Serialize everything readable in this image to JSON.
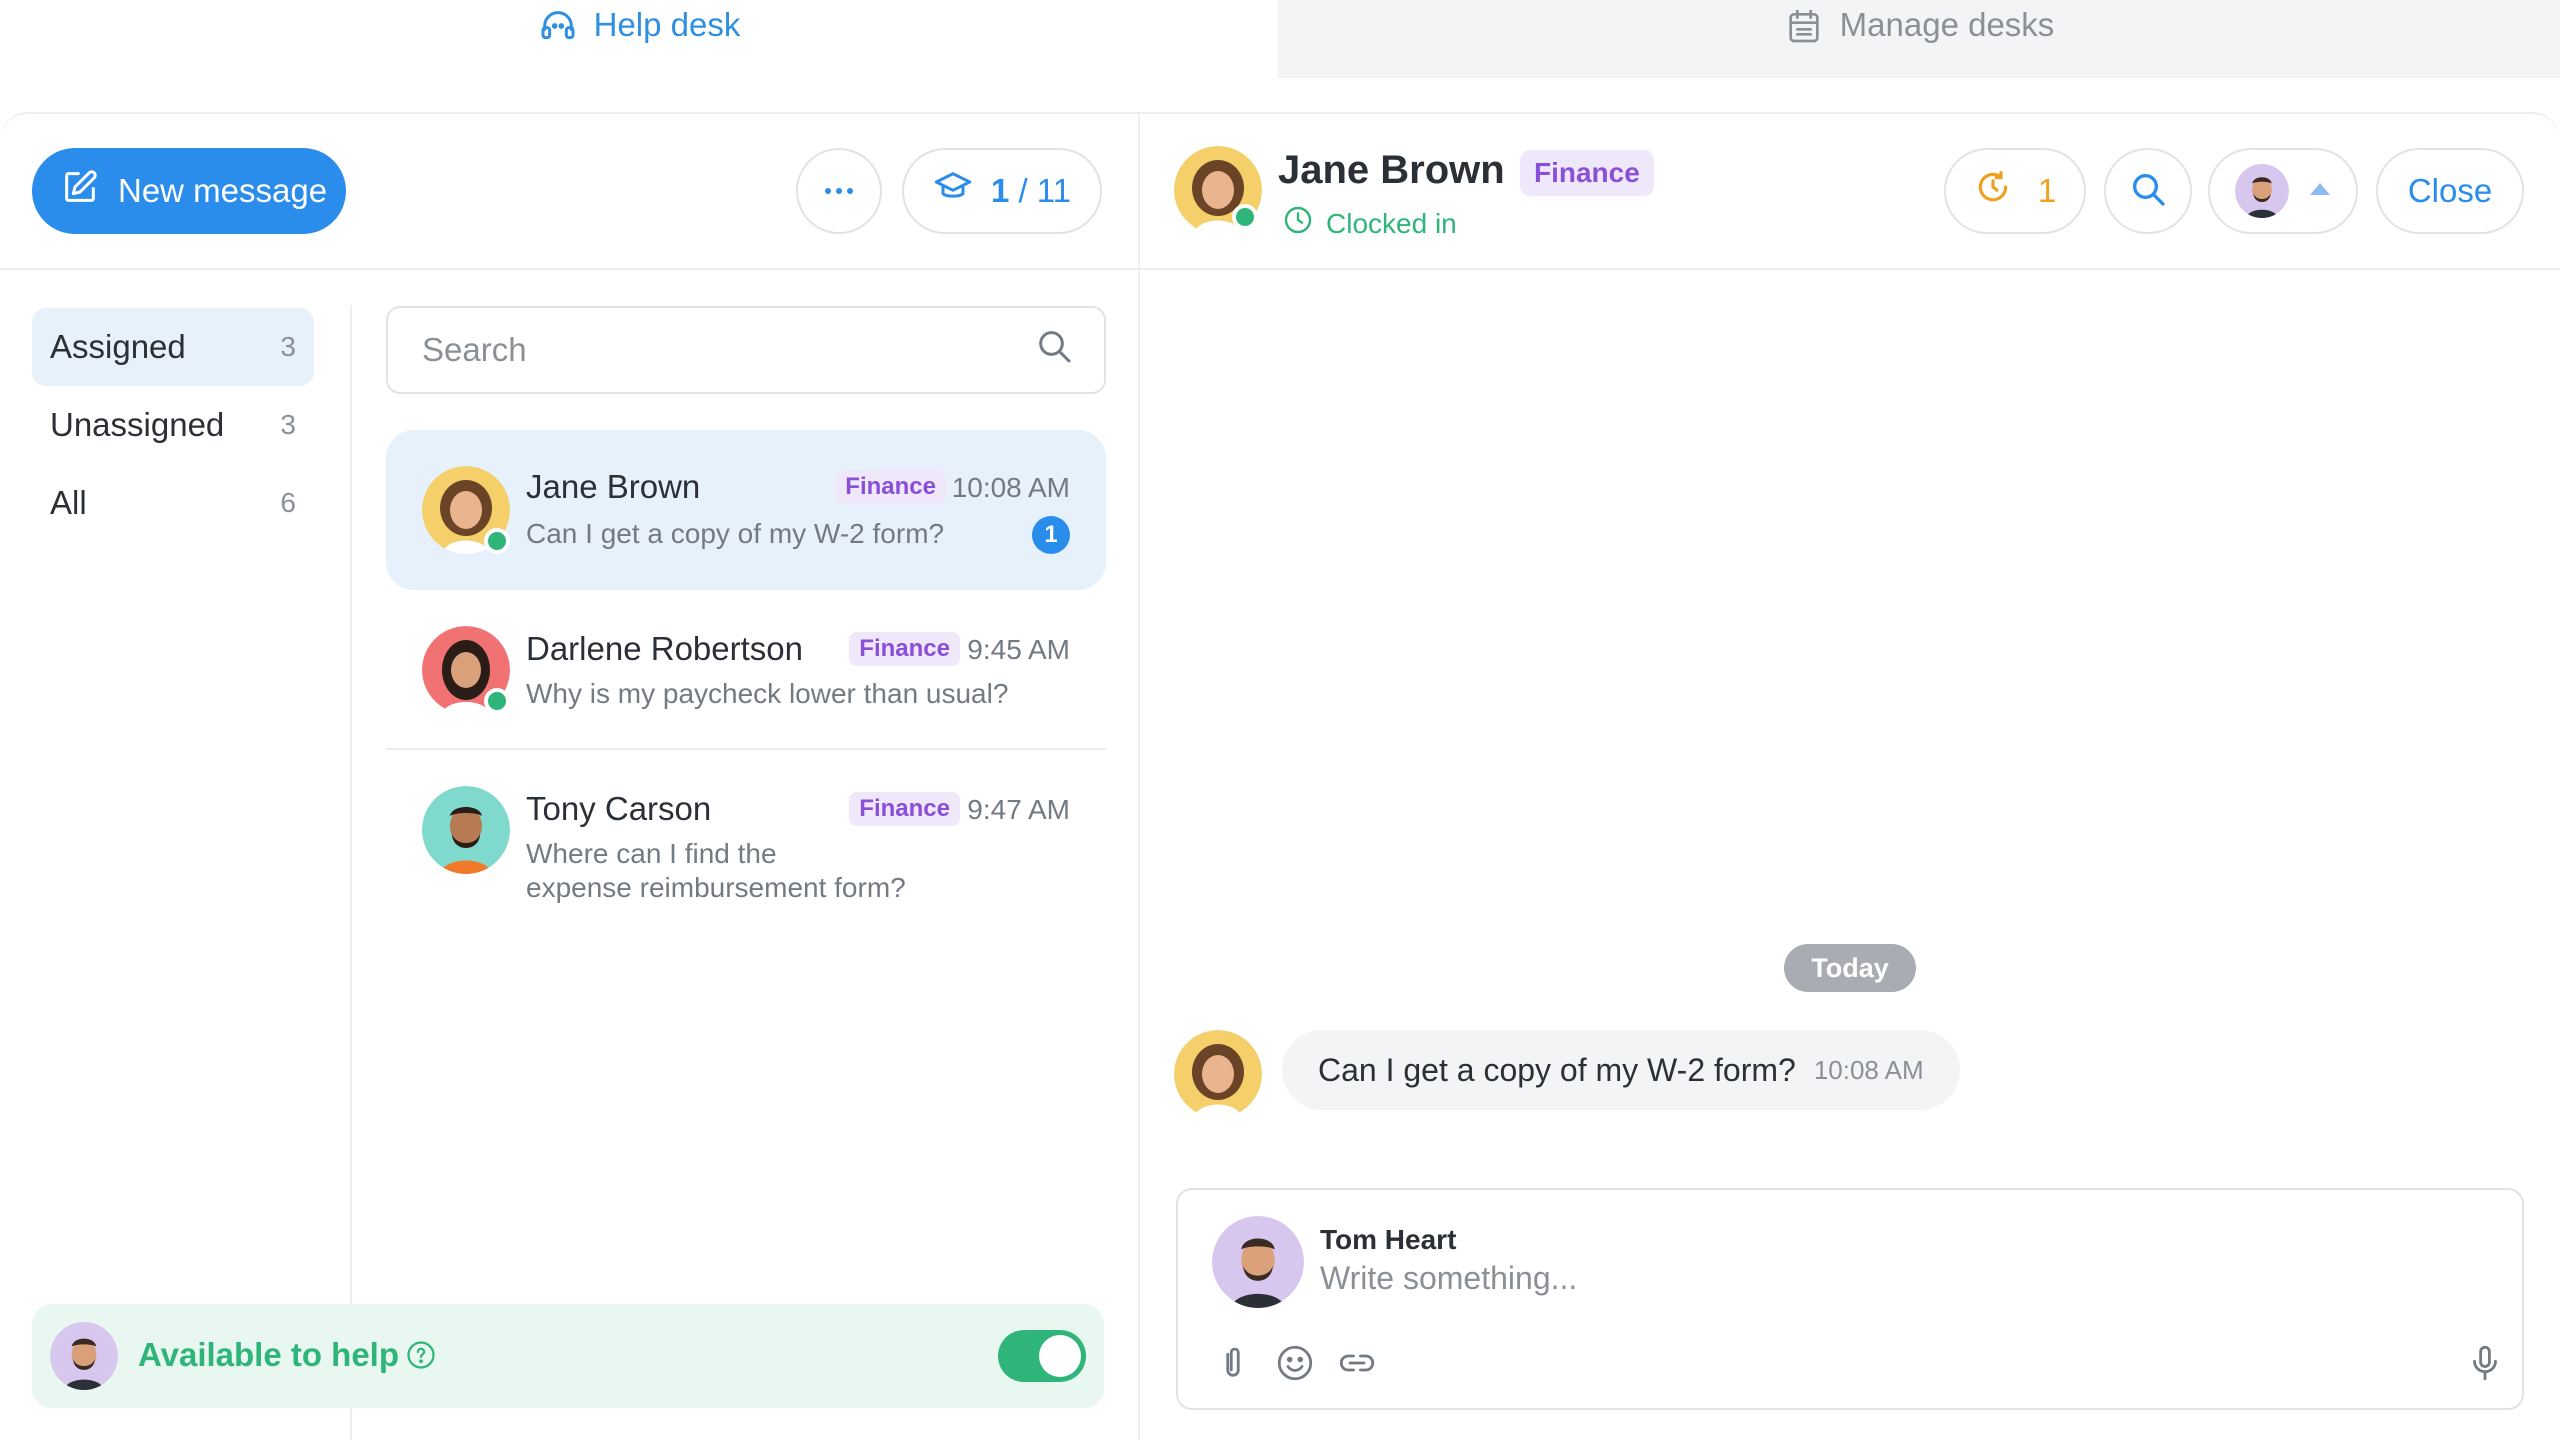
{
  "tabs": {
    "helpdesk": "Help desk",
    "manage": "Manage desks"
  },
  "toolbar": {
    "new_message": "New message",
    "counter_current": "1",
    "counter_total": "/ 11"
  },
  "filters": [
    {
      "label": "Assigned",
      "count": "3"
    },
    {
      "label": "Unassigned",
      "count": "3"
    },
    {
      "label": "All",
      "count": "6"
    }
  ],
  "search": {
    "placeholder": "Search"
  },
  "conversations": [
    {
      "name": "Jane Brown",
      "tag": "Finance",
      "time": "10:08 AM",
      "preview": "Can I get a copy of my W-2 form?",
      "unread": "1"
    },
    {
      "name": "Darlene Robertson",
      "tag": "Finance",
      "time": "9:45 AM",
      "preview": "Why is my paycheck lower than usual?"
    },
    {
      "name": "Tony Carson",
      "tag": "Finance",
      "time": "9:47 AM",
      "preview_line1": "Where can I find the",
      "preview_line2": "expense reimbursement form?"
    }
  ],
  "availability": {
    "label": "Available to help",
    "enabled": true
  },
  "chat": {
    "name": "Jane Brown",
    "tag": "Finance",
    "status": "Clocked in",
    "timer_count": "1",
    "close_label": "Close",
    "day_label": "Today",
    "messages": [
      {
        "text": "Can I get a copy of my W-2 form?",
        "time": "10:08 AM"
      }
    ]
  },
  "composer": {
    "author": "Tom Heart",
    "placeholder": "Write something..."
  },
  "colors": {
    "accent": "#2a8ceb",
    "success": "#2fb57a",
    "tag_bg": "#efe8fb",
    "tag_text": "#8a4fd8",
    "warning": "#f0a020"
  }
}
